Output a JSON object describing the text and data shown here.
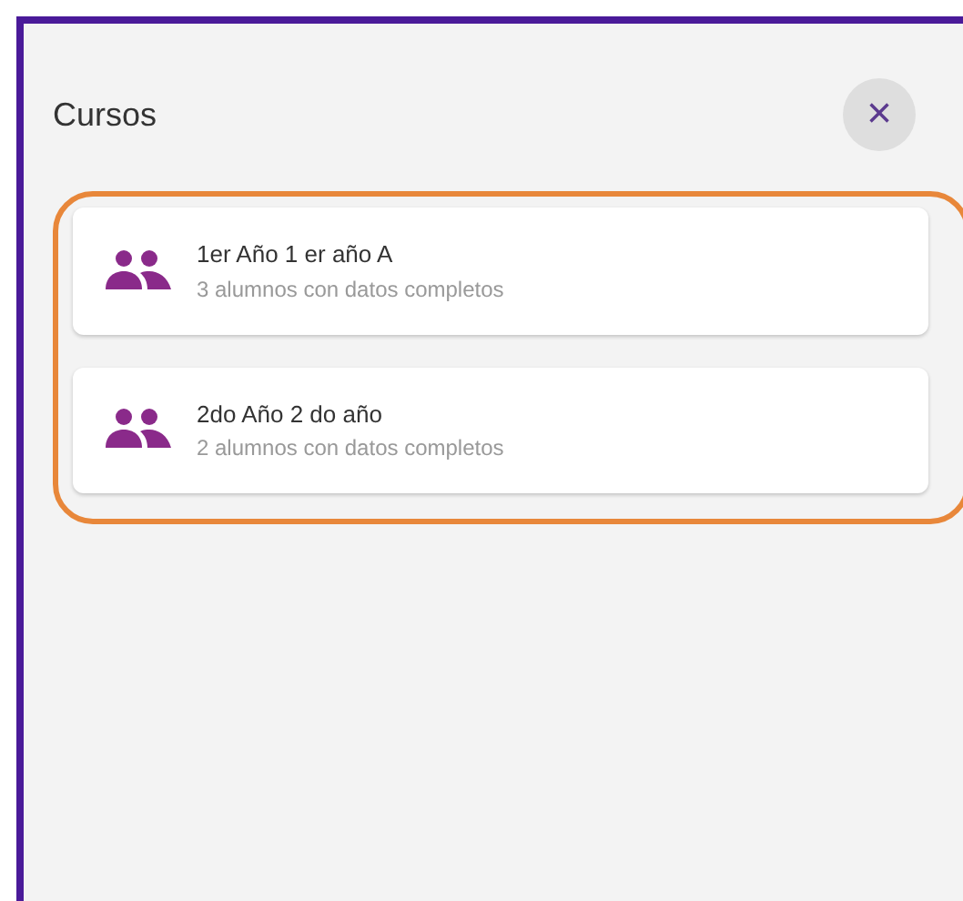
{
  "dialog": {
    "title": "Cursos",
    "close_label": "×"
  },
  "courses": [
    {
      "name": "1er Año 1 er año A",
      "detail": "3 alumnos con datos completos"
    },
    {
      "name": "2do Año 2 do año",
      "detail": "2 alumnos con datos completos"
    }
  ]
}
